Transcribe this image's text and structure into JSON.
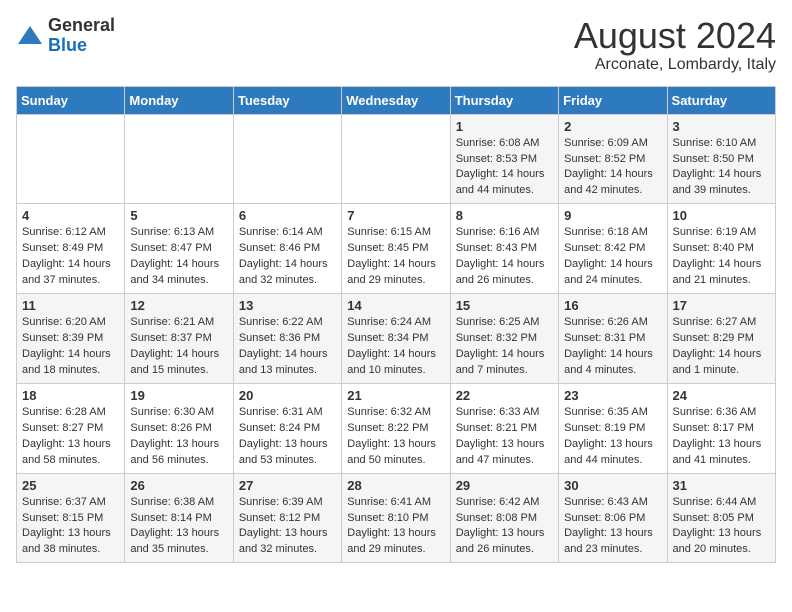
{
  "logo": {
    "general": "General",
    "blue": "Blue"
  },
  "header": {
    "month": "August 2024",
    "location": "Arconate, Lombardy, Italy"
  },
  "days_of_week": [
    "Sunday",
    "Monday",
    "Tuesday",
    "Wednesday",
    "Thursday",
    "Friday",
    "Saturday"
  ],
  "weeks": [
    [
      {
        "day": "",
        "content": ""
      },
      {
        "day": "",
        "content": ""
      },
      {
        "day": "",
        "content": ""
      },
      {
        "day": "",
        "content": ""
      },
      {
        "day": "1",
        "content": "Sunrise: 6:08 AM\nSunset: 8:53 PM\nDaylight: 14 hours and 44 minutes."
      },
      {
        "day": "2",
        "content": "Sunrise: 6:09 AM\nSunset: 8:52 PM\nDaylight: 14 hours and 42 minutes."
      },
      {
        "day": "3",
        "content": "Sunrise: 6:10 AM\nSunset: 8:50 PM\nDaylight: 14 hours and 39 minutes."
      }
    ],
    [
      {
        "day": "4",
        "content": "Sunrise: 6:12 AM\nSunset: 8:49 PM\nDaylight: 14 hours and 37 minutes."
      },
      {
        "day": "5",
        "content": "Sunrise: 6:13 AM\nSunset: 8:47 PM\nDaylight: 14 hours and 34 minutes."
      },
      {
        "day": "6",
        "content": "Sunrise: 6:14 AM\nSunset: 8:46 PM\nDaylight: 14 hours and 32 minutes."
      },
      {
        "day": "7",
        "content": "Sunrise: 6:15 AM\nSunset: 8:45 PM\nDaylight: 14 hours and 29 minutes."
      },
      {
        "day": "8",
        "content": "Sunrise: 6:16 AM\nSunset: 8:43 PM\nDaylight: 14 hours and 26 minutes."
      },
      {
        "day": "9",
        "content": "Sunrise: 6:18 AM\nSunset: 8:42 PM\nDaylight: 14 hours and 24 minutes."
      },
      {
        "day": "10",
        "content": "Sunrise: 6:19 AM\nSunset: 8:40 PM\nDaylight: 14 hours and 21 minutes."
      }
    ],
    [
      {
        "day": "11",
        "content": "Sunrise: 6:20 AM\nSunset: 8:39 PM\nDaylight: 14 hours and 18 minutes."
      },
      {
        "day": "12",
        "content": "Sunrise: 6:21 AM\nSunset: 8:37 PM\nDaylight: 14 hours and 15 minutes."
      },
      {
        "day": "13",
        "content": "Sunrise: 6:22 AM\nSunset: 8:36 PM\nDaylight: 14 hours and 13 minutes."
      },
      {
        "day": "14",
        "content": "Sunrise: 6:24 AM\nSunset: 8:34 PM\nDaylight: 14 hours and 10 minutes."
      },
      {
        "day": "15",
        "content": "Sunrise: 6:25 AM\nSunset: 8:32 PM\nDaylight: 14 hours and 7 minutes."
      },
      {
        "day": "16",
        "content": "Sunrise: 6:26 AM\nSunset: 8:31 PM\nDaylight: 14 hours and 4 minutes."
      },
      {
        "day": "17",
        "content": "Sunrise: 6:27 AM\nSunset: 8:29 PM\nDaylight: 14 hours and 1 minute."
      }
    ],
    [
      {
        "day": "18",
        "content": "Sunrise: 6:28 AM\nSunset: 8:27 PM\nDaylight: 13 hours and 58 minutes."
      },
      {
        "day": "19",
        "content": "Sunrise: 6:30 AM\nSunset: 8:26 PM\nDaylight: 13 hours and 56 minutes."
      },
      {
        "day": "20",
        "content": "Sunrise: 6:31 AM\nSunset: 8:24 PM\nDaylight: 13 hours and 53 minutes."
      },
      {
        "day": "21",
        "content": "Sunrise: 6:32 AM\nSunset: 8:22 PM\nDaylight: 13 hours and 50 minutes."
      },
      {
        "day": "22",
        "content": "Sunrise: 6:33 AM\nSunset: 8:21 PM\nDaylight: 13 hours and 47 minutes."
      },
      {
        "day": "23",
        "content": "Sunrise: 6:35 AM\nSunset: 8:19 PM\nDaylight: 13 hours and 44 minutes."
      },
      {
        "day": "24",
        "content": "Sunrise: 6:36 AM\nSunset: 8:17 PM\nDaylight: 13 hours and 41 minutes."
      }
    ],
    [
      {
        "day": "25",
        "content": "Sunrise: 6:37 AM\nSunset: 8:15 PM\nDaylight: 13 hours and 38 minutes."
      },
      {
        "day": "26",
        "content": "Sunrise: 6:38 AM\nSunset: 8:14 PM\nDaylight: 13 hours and 35 minutes."
      },
      {
        "day": "27",
        "content": "Sunrise: 6:39 AM\nSunset: 8:12 PM\nDaylight: 13 hours and 32 minutes."
      },
      {
        "day": "28",
        "content": "Sunrise: 6:41 AM\nSunset: 8:10 PM\nDaylight: 13 hours and 29 minutes."
      },
      {
        "day": "29",
        "content": "Sunrise: 6:42 AM\nSunset: 8:08 PM\nDaylight: 13 hours and 26 minutes."
      },
      {
        "day": "30",
        "content": "Sunrise: 6:43 AM\nSunset: 8:06 PM\nDaylight: 13 hours and 23 minutes."
      },
      {
        "day": "31",
        "content": "Sunrise: 6:44 AM\nSunset: 8:05 PM\nDaylight: 13 hours and 20 minutes."
      }
    ]
  ]
}
